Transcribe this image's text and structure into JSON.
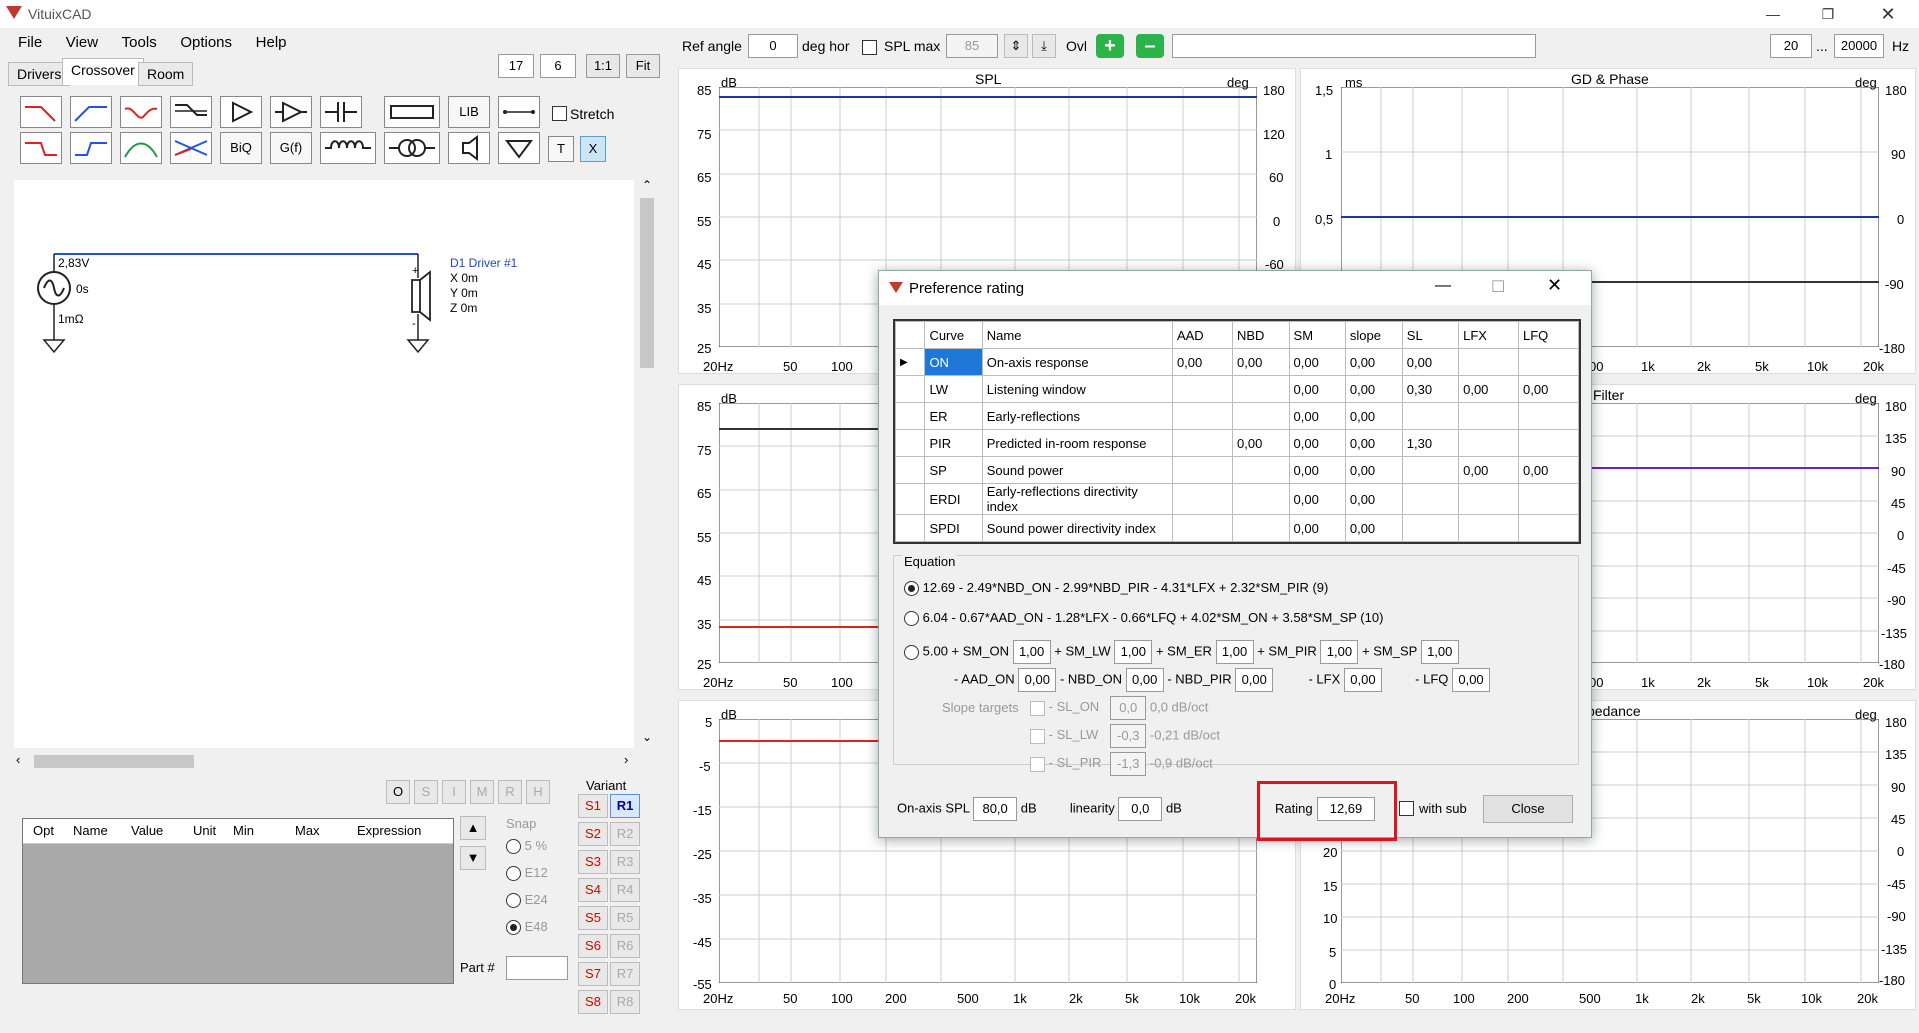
{
  "app": {
    "title": "VituixCAD"
  },
  "menu": [
    "File",
    "View",
    "Tools",
    "Options",
    "Help"
  ],
  "tabs": {
    "drivers": "Drivers",
    "crossover": "Crossover",
    "room": "Room"
  },
  "zoom": {
    "a": "17",
    "b": "6",
    "one": "1:1",
    "fit": "Fit"
  },
  "toolbar": {
    "lib": "LIB",
    "biq": "BiQ",
    "gf": "G(f)",
    "t": "T",
    "x": "X",
    "stretch_label": "Stretch"
  },
  "schematic": {
    "source_v": "2,83V",
    "source_t": "0s",
    "source_r": "1mΩ",
    "driver_name": "D1 Driver #1",
    "driver_x": "X 0m",
    "driver_y": "Y 0m",
    "driver_z": "Z 0m"
  },
  "params_table": {
    "columns": [
      "Opt",
      "Name",
      "Value",
      "Unit",
      "Min",
      "Max",
      "Expression"
    ]
  },
  "opt_buttons": [
    "O",
    "S",
    "I",
    "M",
    "R",
    "H"
  ],
  "snap": {
    "label": "Snap",
    "options": [
      "5 %",
      "E12",
      "E24",
      "E48"
    ]
  },
  "variant": {
    "label": "Variant",
    "s": [
      "S1",
      "S2",
      "S3",
      "S4",
      "S5",
      "S6",
      "S7",
      "S8"
    ],
    "r": [
      "R1",
      "R2",
      "R3",
      "R4",
      "R5",
      "R6",
      "R7",
      "R8"
    ]
  },
  "part_label": "Part #",
  "topbar": {
    "ref_angle_label": "Ref angle",
    "ref_angle": "0",
    "deg_hor": "deg hor",
    "spl_max_label": "SPL max",
    "spl_max": "85",
    "ovl": "Ovl",
    "freq_min": "20",
    "ellipsis": "...",
    "freq_max": "20000",
    "hz": "Hz"
  },
  "plots": {
    "spl": {
      "title": "SPL",
      "unit_left": "dB",
      "unit_right": "deg",
      "y": [
        "85",
        "75",
        "65",
        "55",
        "45",
        "35",
        "25"
      ],
      "y_right": [
        "180",
        "120",
        "60",
        "0",
        "-60"
      ]
    },
    "gd": {
      "title": "GD & Phase",
      "unit_left": "ms",
      "unit_right": "deg",
      "y": [
        "1,5",
        "1",
        "0,5"
      ],
      "y_right": [
        "180",
        "90",
        "0",
        "-90",
        "-180"
      ]
    },
    "mid_left": {
      "unit_left": "dB",
      "y": [
        "85",
        "75",
        "65",
        "55",
        "45",
        "35",
        "25"
      ]
    },
    "mid_right": {
      "title": "Filter",
      "unit_right": "deg",
      "y_right": [
        "180",
        "135",
        "90",
        "45",
        "0",
        "-45",
        "-90",
        "-135",
        "-180"
      ]
    },
    "bot_left": {
      "unit_left": "dB",
      "y": [
        "5",
        "-5",
        "-15",
        "-25",
        "-35",
        "-45",
        "-55"
      ]
    },
    "bot_right": {
      "title": "pedance",
      "unit_right": "deg",
      "y": [
        "20",
        "15",
        "10",
        "5",
        "0"
      ],
      "y_right": [
        "180",
        "135",
        "90",
        "45",
        "0",
        "-45",
        "-90",
        "-135",
        "-180"
      ]
    },
    "x_ticks_short": [
      "20Hz",
      "50",
      "100"
    ],
    "x_ticks_full": [
      "20Hz",
      "50",
      "100",
      "200",
      "500",
      "1k",
      "2k",
      "5k",
      "10k",
      "20k"
    ],
    "x_ticks_right_top": [
      "00",
      "1k",
      "2k",
      "5k",
      "10k",
      "20k"
    ]
  },
  "dialog": {
    "title": "Preference rating",
    "columns": [
      "Curve",
      "Name",
      "AAD",
      "NBD",
      "SM",
      "slope",
      "SL",
      "LFX",
      "LFQ"
    ],
    "rows": [
      {
        "curve": "ON",
        "name": "On-axis response",
        "aad": "0,00",
        "nbd": "0,00",
        "sm": "0,00",
        "slope": "0,00",
        "sl": "0,00",
        "lfx": "",
        "lfq": ""
      },
      {
        "curve": "LW",
        "name": "Listening window",
        "aad": "",
        "nbd": "",
        "sm": "0,00",
        "slope": "0,00",
        "sl": "0,30",
        "lfx": "0,00",
        "lfq": "0,00"
      },
      {
        "curve": "ER",
        "name": "Early-reflections",
        "aad": "",
        "nbd": "",
        "sm": "0,00",
        "slope": "0,00",
        "sl": "",
        "lfx": "",
        "lfq": ""
      },
      {
        "curve": "PIR",
        "name": "Predicted in-room response",
        "aad": "",
        "nbd": "0,00",
        "sm": "0,00",
        "slope": "0,00",
        "sl": "1,30",
        "lfx": "",
        "lfq": ""
      },
      {
        "curve": "SP",
        "name": "Sound power",
        "aad": "",
        "nbd": "",
        "sm": "0,00",
        "slope": "0,00",
        "sl": "",
        "lfx": "0,00",
        "lfq": "0,00"
      },
      {
        "curve": "ERDI",
        "name": "Early-reflections directivity index",
        "aad": "",
        "nbd": "",
        "sm": "0,00",
        "slope": "0,00",
        "sl": "",
        "lfx": "",
        "lfq": ""
      },
      {
        "curve": "SPDI",
        "name": "Sound power directivity index",
        "aad": "",
        "nbd": "",
        "sm": "0,00",
        "slope": "0,00",
        "sl": "",
        "lfx": "",
        "lfq": ""
      }
    ],
    "equation_label": "Equation",
    "eq1": "12.69 - 2.49*NBD_ON - 2.99*NBD_PIR - 4.31*LFX + 2.32*SM_PIR (9)",
    "eq2": "6.04 - 0.67*AAD_ON - 1.28*LFX - 0.66*LFQ + 4.02*SM_ON + 3.58*SM_SP (10)",
    "eq3": {
      "base": "5.00 + SM_ON",
      "sm_on": "1,00",
      "sm_lw_lbl": "+ SM_LW",
      "sm_lw": "1,00",
      "sm_er_lbl": "+ SM_ER",
      "sm_er": "1,00",
      "sm_pir_lbl": "+ SM_PIR",
      "sm_pir": "1,00",
      "sm_sp_lbl": "+ SM_SP",
      "sm_sp": "1,00",
      "aad_on_lbl": "- AAD_ON",
      "aad_on": "0,00",
      "nbd_on_lbl": "- NBD_ON",
      "nbd_on": "0,00",
      "nbd_pir_lbl": "- NBD_PIR",
      "nbd_pir": "0,00",
      "lfx_lbl": "- LFX",
      "lfx": "0,00",
      "lfq_lbl": "- LFQ",
      "lfq": "0,00"
    },
    "slope": {
      "label": "Slope targets",
      "rows": [
        {
          "lbl": "- SL_ON",
          "val": "0,0",
          "txt": "0,0 dB/oct"
        },
        {
          "lbl": "- SL_LW",
          "val": "-0,3",
          "txt": "-0,21 dB/oct"
        },
        {
          "lbl": "- SL_PIR",
          "val": "-1,3",
          "txt": "-0,9 dB/oct"
        }
      ]
    },
    "onaxis_label": "On-axis SPL",
    "onaxis": "80,0",
    "db": "dB",
    "linearity_label": "linearity",
    "linearity": "0,0",
    "rating_label": "Rating",
    "rating": "12,69",
    "with_sub": "with sub",
    "close": "Close"
  }
}
